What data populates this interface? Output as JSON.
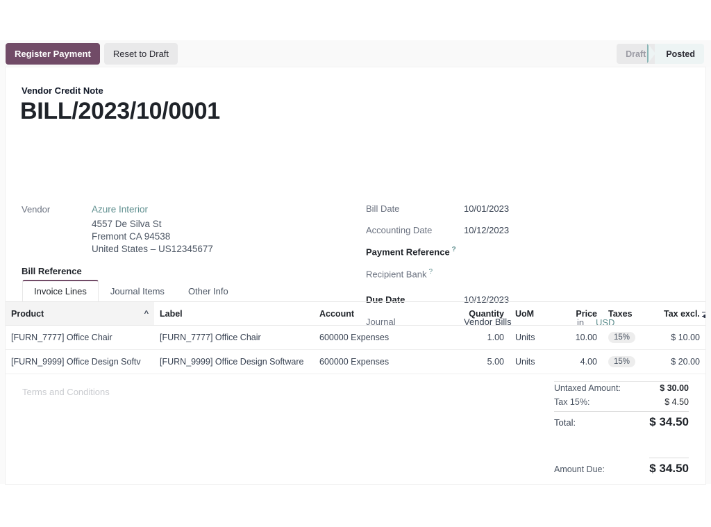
{
  "toolbar": {
    "register_payment": "Register Payment",
    "reset_to_draft": "Reset to Draft"
  },
  "statusbar": {
    "steps": [
      {
        "label": "Draft",
        "active": false
      },
      {
        "label": "Posted",
        "active": true
      }
    ]
  },
  "document": {
    "subtitle": "Vendor Credit Note",
    "title": "BILL/2023/10/0001"
  },
  "left_fields": {
    "vendor_label": "Vendor",
    "vendor_name": "Azure Interior",
    "vendor_address": [
      "4557 De Silva St",
      "Fremont CA 94538",
      "United States – US12345677"
    ],
    "bill_reference_label": "Bill Reference",
    "bill_reference_value": ""
  },
  "right_fields": [
    {
      "label": "Bill Date",
      "value": "10/01/2023",
      "bold": false,
      "help": false
    },
    {
      "label": "Accounting Date",
      "value": "10/12/2023",
      "bold": false,
      "help": false
    },
    {
      "label": "Payment Reference",
      "value": "",
      "bold": true,
      "help": true
    },
    {
      "label": "Recipient Bank",
      "value": "",
      "bold": false,
      "help": true
    },
    {
      "label": "Due Date",
      "value": "10/12/2023",
      "bold": true,
      "help": false
    },
    {
      "label": "Journal",
      "value": "Vendor Bills",
      "bold": false,
      "help": false
    }
  ],
  "currency": {
    "in_label": "in",
    "code": "USD"
  },
  "tabs": [
    {
      "label": "Invoice Lines",
      "active": true
    },
    {
      "label": "Journal Items",
      "active": false
    },
    {
      "label": "Other Info",
      "active": false
    }
  ],
  "table": {
    "columns": [
      "Product",
      "Label",
      "Account",
      "Quantity",
      "UoM",
      "Price",
      "Taxes",
      "Tax excl."
    ],
    "sort_column": "Product",
    "sort_direction": "asc",
    "options_icon": "sliders-icon",
    "rows": [
      {
        "product": "[FURN_7777] Office Chair",
        "label": "[FURN_7777] Office Chair",
        "account": "600000 Expenses",
        "quantity": "1.00",
        "uom": "Units",
        "price": "10.00",
        "taxes": "15%",
        "tax_excl": "$ 10.00"
      },
      {
        "product": "[FURN_9999] Office Design Softv",
        "label": "[FURN_9999] Office Design Software",
        "account": "600000 Expenses",
        "quantity": "5.00",
        "uom": "Units",
        "price": "4.00",
        "taxes": "15%",
        "tax_excl": "$ 20.00"
      }
    ]
  },
  "terms_placeholder": "Terms and Conditions",
  "totals": {
    "untaxed_label": "Untaxed Amount:",
    "untaxed_value": "$ 30.00",
    "tax_label": "Tax 15%:",
    "tax_value": "$ 4.50",
    "total_label": "Total:",
    "total_value": "$ 34.50",
    "amount_due_label": "Amount Due:",
    "amount_due_value": "$ 34.50"
  },
  "colors": {
    "primary": "#714b67",
    "link": "#5f8f8f",
    "status_active_bg": "#edf4f4",
    "status_inactive_bg": "#e9e9ea"
  }
}
